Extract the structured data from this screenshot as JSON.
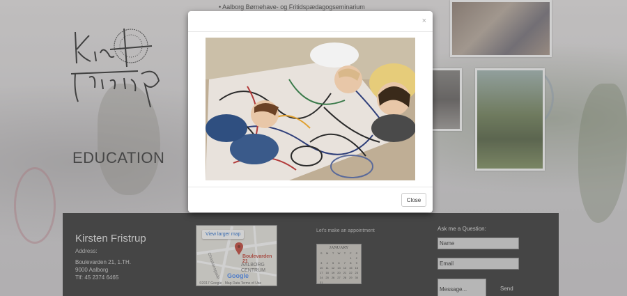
{
  "background": {
    "top_text": "• Aalborg Børnehave- og Fritidspædagogseminarium",
    "section_heading": "EDUCATION"
  },
  "footer": {
    "name": "Kirsten Fristrup",
    "address_label": "Address:",
    "address_lines": [
      "Boulevarden 21, 1.TH.",
      "9000 Aalborg",
      "Tlf: 45 2374 6465"
    ],
    "map": {
      "view_larger": "View larger map",
      "place_label": "Boulevarden 21",
      "area_label_1": "AALBORG",
      "area_label_2": "CENTRUM",
      "street_label": "Christiansgade",
      "brand": "Google",
      "copyright": "©2017 Google · Map Data   Terms of Use"
    },
    "appointment_label": "Let's make an appointment",
    "calendar": {
      "month": "JANUARY",
      "weekdays": [
        "S",
        "M",
        "T",
        "W",
        "T",
        "F",
        "S"
      ],
      "days": [
        "",
        "",
        "",
        "",
        "",
        "1",
        "2",
        "3",
        "4",
        "5",
        "6",
        "7",
        "8",
        "9",
        "10",
        "11",
        "12",
        "13",
        "14",
        "15",
        "16",
        "17",
        "18",
        "19",
        "20",
        "21",
        "22",
        "23",
        "24",
        "25",
        "26",
        "27",
        "28",
        "29",
        "30",
        "31"
      ]
    },
    "ask_label": "Ask me a Question:",
    "name_placeholder": "Name",
    "email_placeholder": "Email",
    "message_placeholder": "Message...",
    "send_label": "Send"
  },
  "modal": {
    "close_x": "×",
    "close_button": "Close"
  },
  "colors": {
    "footer_bg": "#2a2a2a",
    "map_pin": "#c0392b"
  }
}
